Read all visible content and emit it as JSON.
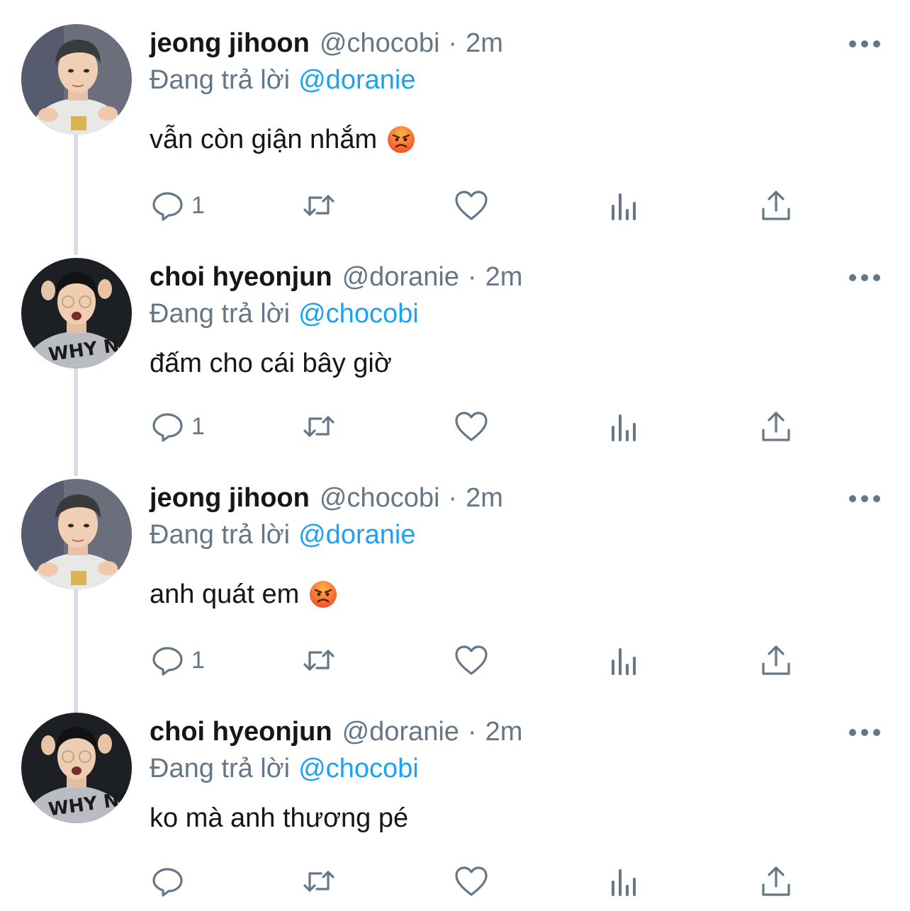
{
  "colors": {
    "name": "#14171a",
    "secondary": "#657786",
    "mention": "#1da1f2",
    "thread_line": "#d8dee3"
  },
  "icons": {
    "reply": "speech-bubble-icon",
    "retweet": "retweet-icon",
    "like": "heart-icon",
    "stats": "bar-chart-icon",
    "share": "share-icon",
    "more": "more-dots-icon",
    "emoji": "angry-face-emoji"
  },
  "tweets": [
    {
      "display_name": "jeong jihoon",
      "handle": "@chocobi",
      "separator": "·",
      "time": "2m",
      "replying_to_label": "Đang trả lời",
      "replying_to": "@doranie",
      "text": "vẫn còn giận nhắm",
      "has_emoji": true,
      "reply_count": "1"
    },
    {
      "display_name": "choi hyeonjun",
      "handle": "@doranie",
      "separator": "·",
      "time": "2m",
      "replying_to_label": "Đang trả lời",
      "replying_to": "@chocobi",
      "text": "đấm cho cái bây giờ",
      "has_emoji": false,
      "reply_count": "1"
    },
    {
      "display_name": "jeong jihoon",
      "handle": "@chocobi",
      "separator": "·",
      "time": "2m",
      "replying_to_label": "Đang trả lời",
      "replying_to": "@doranie",
      "text": "anh quát em",
      "has_emoji": true,
      "reply_count": "1"
    },
    {
      "display_name": "choi hyeonjun",
      "handle": "@doranie",
      "separator": "·",
      "time": "2m",
      "replying_to_label": "Đang trả lời",
      "replying_to": "@chocobi",
      "text": "ko mà anh thương pé",
      "has_emoji": false,
      "reply_count": ""
    }
  ]
}
